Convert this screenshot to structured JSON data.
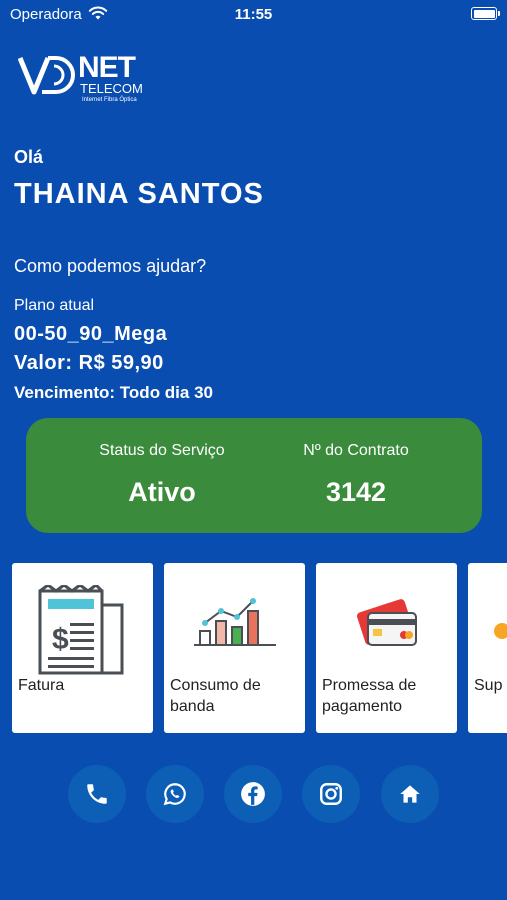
{
  "status_bar": {
    "carrier": "Operadora",
    "time": "11:55"
  },
  "logo": {
    "net": "NET",
    "telecom": "TELECOM",
    "subtitle": "Internet Fibra Óptica"
  },
  "greeting": {
    "hello": "Olá",
    "name": "THAINA SANTOS",
    "help": "Como podemos ajudar?"
  },
  "plan": {
    "label": "Plano atual",
    "name": "00-50_90_Mega",
    "value": "Valor: R$ 59,90",
    "due": "Vencimento: Todo dia 30"
  },
  "service": {
    "status_label": "Status do Serviço",
    "status_value": "Ativo",
    "contract_label": "Nº do Contrato",
    "contract_value": "3142",
    "color": "#3a8b3c"
  },
  "menu": {
    "items": [
      {
        "label": "Fatura",
        "icon": "invoice-icon"
      },
      {
        "label": "Consumo de banda",
        "icon": "bandwidth-chart-icon"
      },
      {
        "label": "Promessa de pagamento",
        "icon": "credit-card-icon"
      },
      {
        "label": "Sup",
        "icon": "support-icon"
      }
    ]
  },
  "social": [
    "phone-icon",
    "whatsapp-icon",
    "facebook-icon",
    "instagram-icon",
    "home-icon"
  ],
  "colors": {
    "background": "#0a4db0",
    "social_button": "#0c5fb5"
  }
}
